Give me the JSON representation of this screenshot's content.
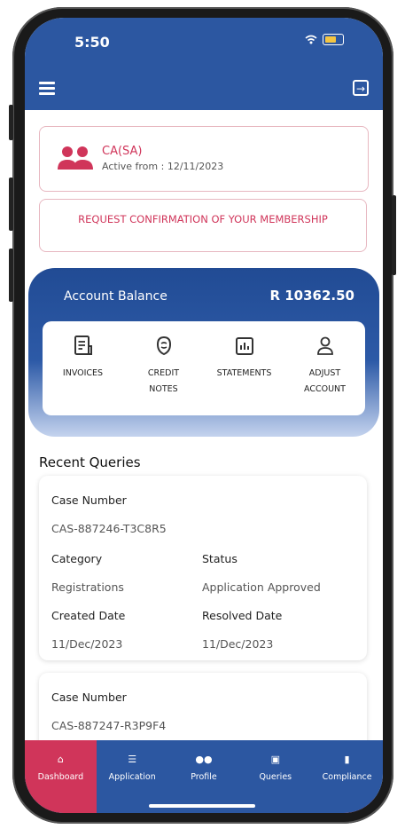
{
  "status_bar": {
    "time": "5:50"
  },
  "appbar": {
    "menu_icon": "hamburger-icon",
    "logout_icon": "logout-icon"
  },
  "membership": {
    "title": "CA(SA)",
    "subtitle": "Active from : 12/11/2023",
    "icon": "members-icon"
  },
  "request_button": {
    "label": "REQUEST CONFIRMATION OF YOUR MEMBERSHIP"
  },
  "balance": {
    "label": "Account Balance",
    "value": "R 10362.50"
  },
  "actions": [
    {
      "label": "INVOICES",
      "icon": "invoice-icon"
    },
    {
      "label": "CREDIT\nNOTES",
      "icon": "credit-notes-icon"
    },
    {
      "label": "STATEMENTS",
      "icon": "statements-icon"
    },
    {
      "label": "ADJUST\nACCOUNT",
      "icon": "user-icon"
    }
  ],
  "recent_queries": {
    "title": "Recent Queries",
    "items": [
      {
        "case_number_label": "Case Number",
        "case_number": "CAS-887246-T3C8R5",
        "category_label": "Category",
        "category": "Registrations",
        "status_label": "Status",
        "status": "Application Approved",
        "created_label": "Created Date",
        "created": "11/Dec/2023",
        "resolved_label": "Resolved Date",
        "resolved": "11/Dec/2023"
      },
      {
        "case_number_label": "Case Number",
        "case_number": "CAS-887247-R3P9F4"
      }
    ]
  },
  "fab": {
    "icon": "chat-icon"
  },
  "bottom_nav": [
    {
      "label": "Dashboard",
      "icon": "home-icon",
      "active": true
    },
    {
      "label": "Application",
      "icon": "list-icon",
      "active": false
    },
    {
      "label": "Profile",
      "icon": "people-icon",
      "active": false
    },
    {
      "label": "Queries",
      "icon": "chat-icon",
      "active": false
    },
    {
      "label": "Compliance",
      "icon": "document-icon",
      "active": false
    }
  ],
  "colors": {
    "primary": "#2c57a1",
    "accent": "#d0355a"
  }
}
